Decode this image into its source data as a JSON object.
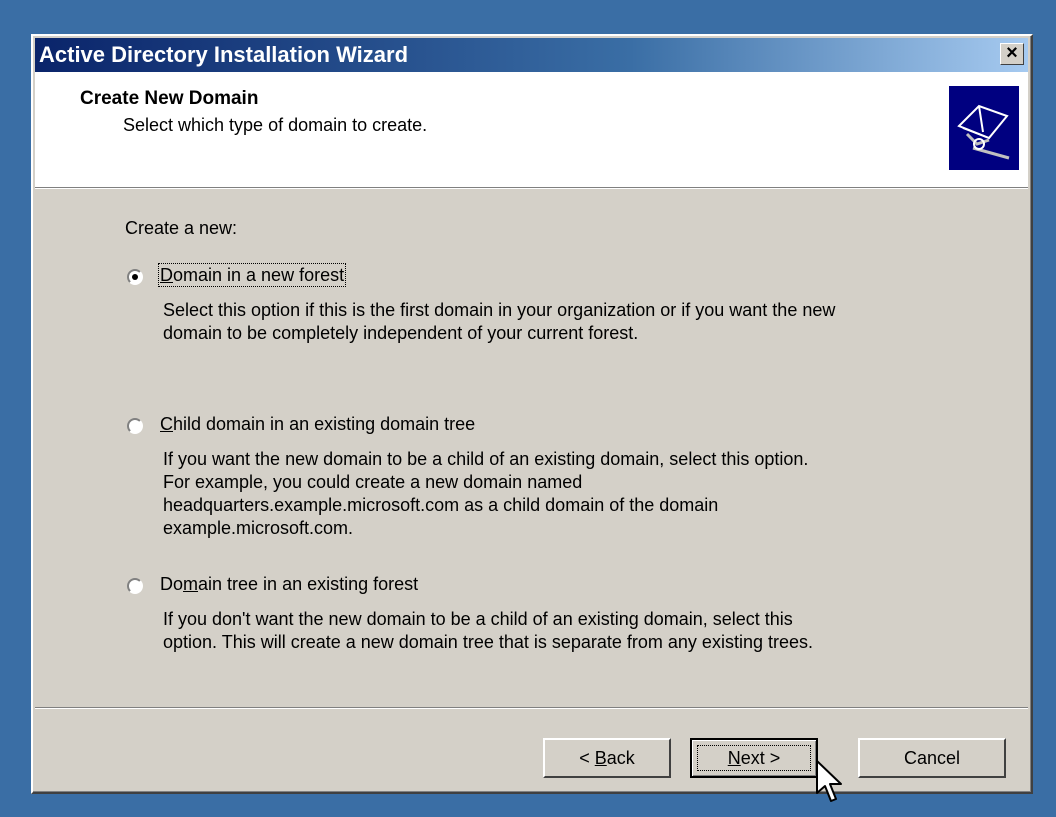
{
  "window": {
    "title": "Active Directory Installation Wizard"
  },
  "header": {
    "title": "Create New Domain",
    "subtitle": "Select which type of domain to create."
  },
  "content": {
    "lead": "Create a new:",
    "options": [
      {
        "label_access": "D",
        "label_rest": "omain in a new forest",
        "selected": true,
        "description": [
          "Select this option if this is the first domain in your organization or if you want the new",
          "domain to be completely independent of your current forest."
        ]
      },
      {
        "label_access": "C",
        "label_rest": "hild domain in an existing domain tree",
        "selected": false,
        "description": [
          "If you want the new domain to be a child of an existing domain, select this option.",
          "For example, you could create a new domain named",
          "headquarters.example.microsoft.com as a child domain of the domain",
          "example.microsoft.com."
        ]
      },
      {
        "label_pre": "Do",
        "label_access": "m",
        "label_rest": "ain tree in an existing forest",
        "selected": false,
        "description": [
          "If you don't want the new domain to be a child of an existing domain, select this",
          "option. This will create a new domain tree that is separate from any existing trees."
        ]
      }
    ]
  },
  "buttons": {
    "back_pre": "< ",
    "back_access": "B",
    "back_rest": "ack",
    "next_access": "N",
    "next_rest": "ext >",
    "cancel": "Cancel"
  },
  "icons": {
    "close": "close-icon",
    "wizard": "book-icon"
  },
  "colors": {
    "desktop": "#3a6ea5",
    "titlebar": "#0a246a",
    "dialog": "#d4d0c8"
  }
}
